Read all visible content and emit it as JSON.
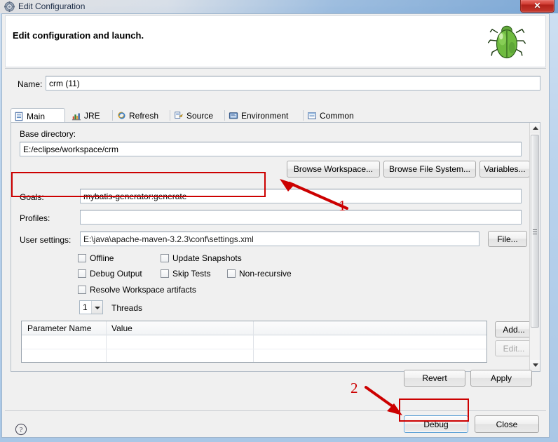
{
  "window": {
    "title": "Edit Configuration",
    "title_icon": "gear-icon",
    "close_label": "✕"
  },
  "header": {
    "title": "Edit configuration and launch.",
    "icon": "green-bug-icon"
  },
  "name": {
    "label": "Name:",
    "value": "crm (11)"
  },
  "tabs": [
    {
      "label": "Main",
      "icon": "document-icon",
      "active": true
    },
    {
      "label": "JRE",
      "icon": "jre-icon",
      "active": false
    },
    {
      "label": "Refresh",
      "icon": "refresh-icon",
      "active": false
    },
    {
      "label": "Source",
      "icon": "source-icon",
      "active": false
    },
    {
      "label": "Environment",
      "icon": "environment-icon",
      "active": false
    },
    {
      "label": "Common",
      "icon": "common-icon",
      "active": false
    }
  ],
  "main": {
    "base_directory_label": "Base directory:",
    "base_directory_value": "E:/eclipse/workspace/crm",
    "browse_workspace_label": "Browse Workspace...",
    "browse_file_system_label": "Browse File System...",
    "variables_label": "Variables...",
    "goals_label": "Goals:",
    "goals_value": "mybatis-generator:generate",
    "profiles_label": "Profiles:",
    "profiles_value": "",
    "user_settings_label": "User settings:",
    "user_settings_value": "E:\\java\\apache-maven-3.2.3\\conf\\settings.xml",
    "file_button_label": "File...",
    "checkboxes": [
      {
        "label": "Offline",
        "checked": false
      },
      {
        "label": "Update Snapshots",
        "checked": false
      },
      {
        "label": "Debug Output",
        "checked": false
      },
      {
        "label": "Skip Tests",
        "checked": false
      },
      {
        "label": "Non-recursive",
        "checked": false
      },
      {
        "label": "Resolve Workspace artifacts",
        "checked": false
      }
    ],
    "threads_value": "1",
    "threads_label": "Threads",
    "table": {
      "columns": [
        "Parameter Name",
        "Value"
      ],
      "rows": []
    },
    "add_label": "Add...",
    "edit_label": "Edit..."
  },
  "footer": {
    "revert_label": "Revert",
    "apply_label": "Apply",
    "debug_label": "Debug",
    "close_label": "Close",
    "help_icon": "question-mark-icon"
  },
  "annotations": {
    "marker_one": "1",
    "marker_two": "2",
    "color": "#cc0000"
  }
}
